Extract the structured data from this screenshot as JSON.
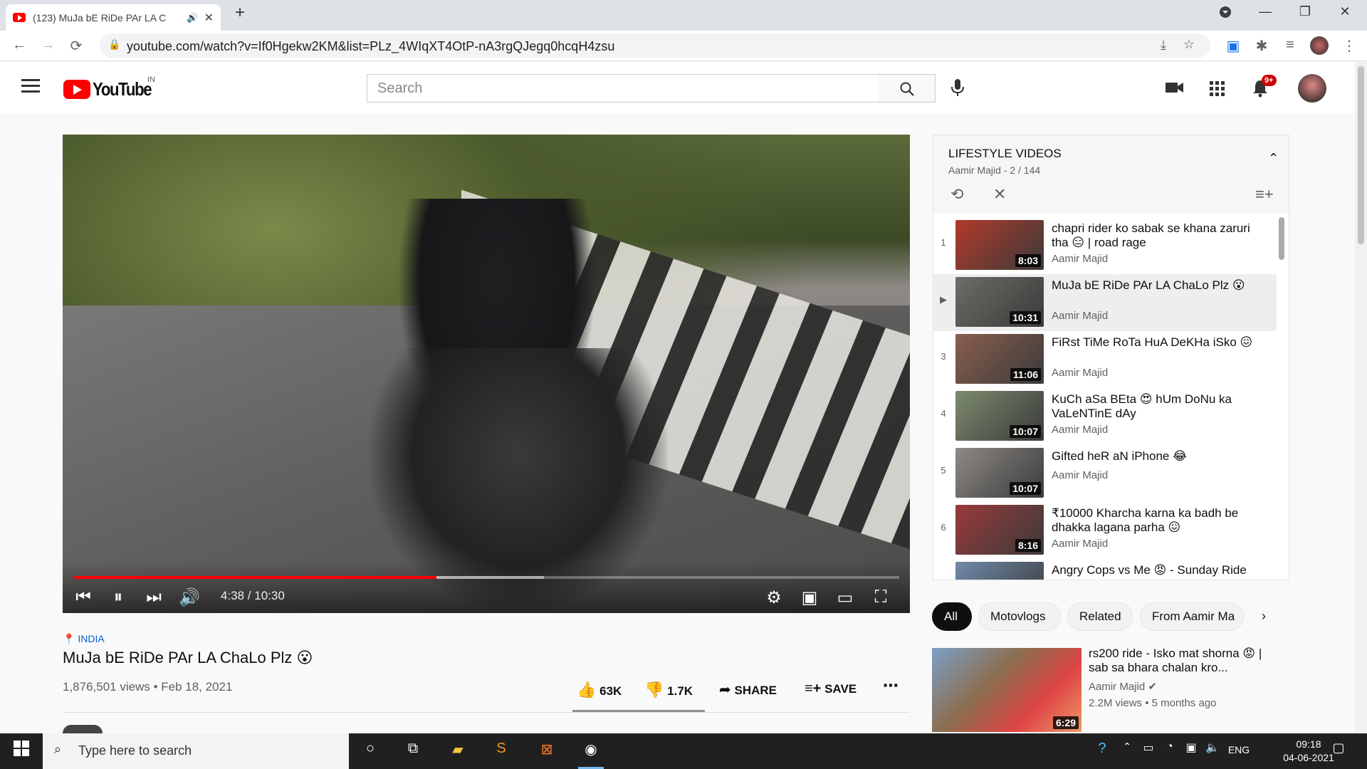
{
  "browser": {
    "tab_title": "(123) MuJa bE RiDe PAr LA C",
    "tab_audio_icon": "speaker-icon",
    "url": "youtube.com/watch?v=If0Hgekw2KM&list=PLz_4WIqXT4OtP-nA3rgQJegq0hcqH4zsu"
  },
  "youtube": {
    "logo_text": "YouTube",
    "region": "IN",
    "search_placeholder": "Search",
    "notifications_badge": "9+"
  },
  "player": {
    "time": "4:38 / 10:30",
    "progress_fraction": 0.44,
    "buffered_fraction": 0.57
  },
  "video": {
    "location": "INDIA",
    "title": "MuJa bE RiDe PAr LA ChaLo Plz 😮",
    "meta": "1,876,501 views • Feb 18, 2021",
    "likes": "63K",
    "dislikes": "1.7K",
    "share_label": "SHARE",
    "save_label": "SAVE"
  },
  "playlist": {
    "title": "LIFESTYLE VIDEOS",
    "subtitle": "Aamir Majid - 2 / 144",
    "items": [
      {
        "index": "1",
        "title": "chapri rider ko sabak se khana zaruri tha 😑 | road rage",
        "author": "Aamir Majid",
        "duration": "8:03",
        "thumb": "#b23a2a"
      },
      {
        "index": "▶",
        "title": "MuJa bE RiDe PAr LA ChaLo Plz 😮",
        "author": "Aamir Majid",
        "duration": "10:31",
        "thumb": "#6a6e66"
      },
      {
        "index": "3",
        "title": "FiRst TiMe RoTa HuA DeKHa iSko 😖",
        "author": "Aamir Majid",
        "duration": "11:06",
        "thumb": "#8a5e4e"
      },
      {
        "index": "4",
        "title": "KuCh aSa BEta 😍 hUm DoNu ka VaLeNTinE dAy",
        "author": "Aamir Majid",
        "duration": "10:07",
        "thumb": "#7c8a6e"
      },
      {
        "index": "5",
        "title": "Gifted heR aN iPhone 😂",
        "author": "Aamir Majid",
        "duration": "10:07",
        "thumb": "#8e8a86"
      },
      {
        "index": "6",
        "title": "₹10000 Kharcha karna ka badh be dhakka lagana parha 😖",
        "author": "Aamir Majid",
        "duration": "8:16",
        "thumb": "#9a3a3a"
      },
      {
        "index": "",
        "title": "Angry Cops vs Me 😡 - Sunday Ride",
        "author": "",
        "duration": "",
        "thumb": "#6f8aa8"
      }
    ]
  },
  "chips": [
    "All",
    "Motovlogs",
    "Related",
    "From Aamir Ma"
  ],
  "recommendation": {
    "title": "rs200 ride - Isko mat shorna 😡 | sab sa bhara chalan kro...",
    "channel": "Aamir Majid",
    "stats": "2.2M views • 5 months ago",
    "duration": "6:29"
  },
  "taskbar": {
    "search_placeholder": "Type here to search",
    "language": "ENG",
    "time": "09:18",
    "date": "04-06-2021"
  }
}
